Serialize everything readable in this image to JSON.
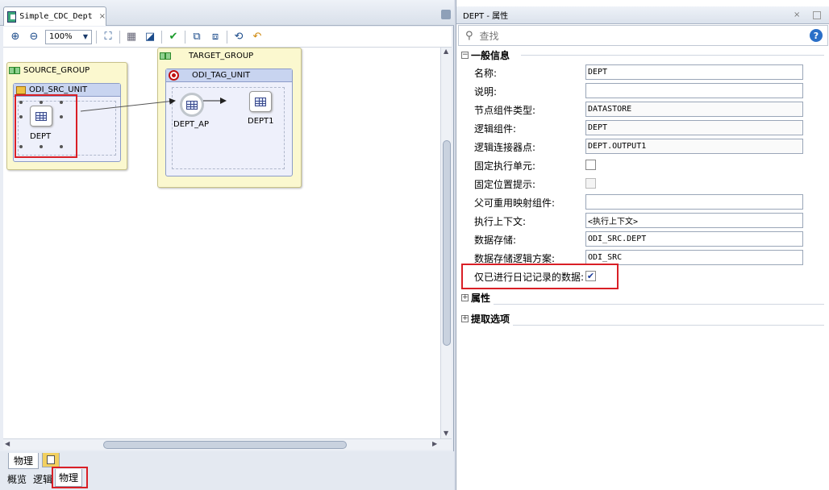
{
  "editor": {
    "tab_title": "Simple_CDC_Dept",
    "tab_close": "×",
    "zoom": "100%",
    "icons": [
      "zoom-in-icon",
      "zoom-out-icon",
      "fit-icon",
      "grid-icon",
      "layout-icon",
      "validate-check-icon",
      "group-icon",
      "ungroup-icon",
      "refresh-icon",
      "undo-icon"
    ]
  },
  "canvas": {
    "source_group": {
      "title": "SOURCE_GROUP",
      "unit_title": "ODI_SRC_UNIT",
      "node_label": "DEPT"
    },
    "target_group": {
      "title": "TARGET_GROUP",
      "unit_title": "ODI_TAG_UNIT",
      "ap_label": "DEPT_AP",
      "target_label": "DEPT1"
    }
  },
  "bottom_tabs": {
    "upper": [
      "物理"
    ],
    "lower": [
      "概览",
      "逻辑",
      "物理"
    ]
  },
  "properties": {
    "title": "DEPT - 属性",
    "search_placeholder": "查找",
    "help": "?",
    "sections": {
      "general": "一般信息",
      "attributes": "属性",
      "extract": "提取选项"
    },
    "rows": [
      {
        "label": "名称:",
        "value": "DEPT"
      },
      {
        "label": "说明:",
        "value": ""
      },
      {
        "label": "节点组件类型:",
        "value": "DATASTORE"
      },
      {
        "label": "逻辑组件:",
        "value": "DEPT"
      },
      {
        "label": "逻辑连接器点:",
        "value": "DEPT.OUTPUT1"
      },
      {
        "label": "固定执行单元:",
        "checkbox": false
      },
      {
        "label": "固定位置提示:",
        "checkbox": false
      },
      {
        "label": "父可重用映射组件:",
        "value": ""
      },
      {
        "label": "执行上下文:",
        "value": "<执行上下文>"
      },
      {
        "label": "数据存储:",
        "value": "ODI_SRC.DEPT"
      },
      {
        "label": "数据存储逻辑方案:",
        "value": "ODI_SRC"
      },
      {
        "label": "仅已进行日记记录的数据:",
        "checkbox": true
      }
    ],
    "check_mark": "✔"
  },
  "colors": {
    "highlight": "#d91f26",
    "group_fill": "#fbf8cf",
    "unit_header": "#c8d4f0"
  }
}
